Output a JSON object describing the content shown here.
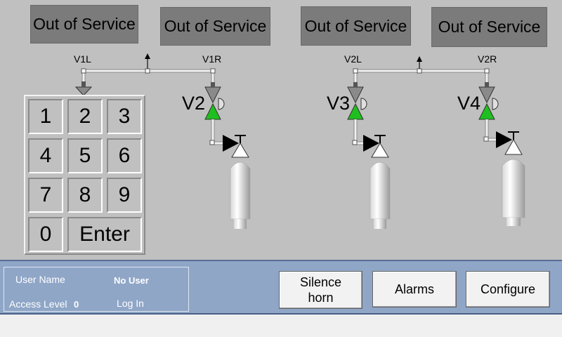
{
  "status_boxes": [
    "Out of Service",
    "Out of Service",
    "Out of Service",
    "Out of Service"
  ],
  "valve_labels": {
    "v1l": "V1L",
    "v1r": "V1R",
    "v2l": "V2L",
    "v2r": "V2R"
  },
  "valve_names": {
    "v2": "V2",
    "v3": "V3",
    "v4": "V4"
  },
  "keypad": {
    "keys": [
      "1",
      "2",
      "3",
      "4",
      "5",
      "6",
      "7",
      "8",
      "9",
      "0"
    ],
    "enter": "Enter"
  },
  "user_panel": {
    "user_name_label": "User Name",
    "user_name_value": "No User",
    "access_level_label": "Access Level",
    "access_level_value": "0",
    "login_label": "Log In"
  },
  "buttons": {
    "silence_line1": "Silence",
    "silence_line2": "horn",
    "alarms": "Alarms",
    "configure": "Configure"
  },
  "colors": {
    "background": "#c0c0c0",
    "status_box": "#7b7b7b",
    "valve_open": "#1fbf1f",
    "valve_grey": "#8a8a8a",
    "bottom_bar": "#8fa6c7"
  }
}
